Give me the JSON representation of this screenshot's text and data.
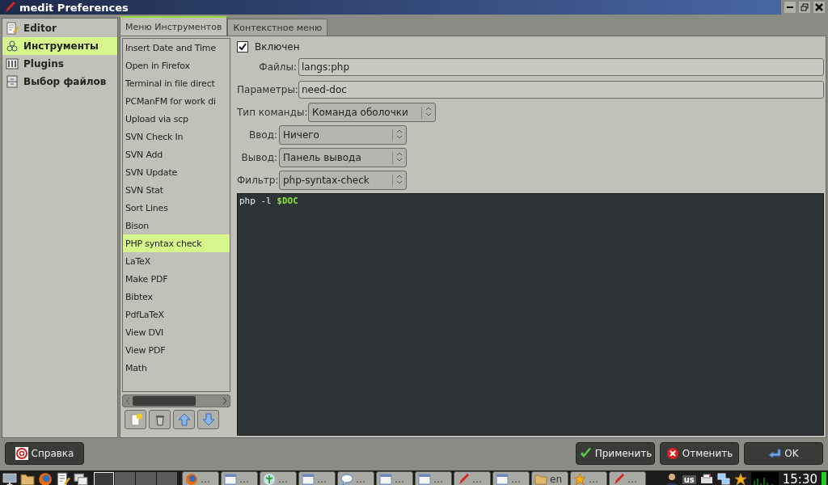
{
  "window": {
    "title": "medit Preferences"
  },
  "sidebar": {
    "items": [
      {
        "label": "Editor",
        "selected": false
      },
      {
        "label": "Инструменты",
        "selected": true
      },
      {
        "label": "Plugins",
        "selected": false
      },
      {
        "label": "Выбор файлов",
        "selected": false
      }
    ]
  },
  "tabs": [
    {
      "label": "Меню Инструментов",
      "selected": true
    },
    {
      "label": "Контекстное меню",
      "selected": false
    }
  ],
  "tools": {
    "items": [
      {
        "label": "Insert Date and Time",
        "selected": false
      },
      {
        "label": "Open in Firefox",
        "selected": false
      },
      {
        "label": "Terminal in file direct",
        "selected": false
      },
      {
        "label": "PCManFM for work di",
        "selected": false
      },
      {
        "label": "Upload via scp",
        "selected": false
      },
      {
        "label": "SVN Check In",
        "selected": false
      },
      {
        "label": "SVN Add",
        "selected": false
      },
      {
        "label": "SVN Update",
        "selected": false
      },
      {
        "label": "SVN Stat",
        "selected": false
      },
      {
        "label": "Sort Lines",
        "selected": false
      },
      {
        "label": "Bison",
        "selected": false
      },
      {
        "label": "PHP syntax check",
        "selected": true
      },
      {
        "label": "LaTeX",
        "selected": false
      },
      {
        "label": "Make PDF",
        "selected": false
      },
      {
        "label": "Bibtex",
        "selected": false
      },
      {
        "label": "PdfLaTeX",
        "selected": false
      },
      {
        "label": "View DVI",
        "selected": false
      },
      {
        "label": "View PDF",
        "selected": false
      },
      {
        "label": "Math",
        "selected": false
      }
    ]
  },
  "form": {
    "enabled": {
      "label": "Включен",
      "checked": true
    },
    "entries": [
      {
        "label": "Файлы:",
        "value": "langs:php"
      },
      {
        "label": "Параметры:",
        "value": "need-doc"
      }
    ],
    "command_type": {
      "label": "Тип команды:",
      "value": "Команда оболочки"
    },
    "io": [
      {
        "label": "Ввод:",
        "value": "Ничего"
      },
      {
        "label": "Вывод:",
        "value": "Панель вывода"
      },
      {
        "label": "Фильтр:",
        "value": "php-syntax-check"
      }
    ],
    "editor": [
      {
        "kind": "text",
        "text": "php -l "
      },
      {
        "kind": "variable",
        "text": "$DOC"
      }
    ]
  },
  "buttons_left": [
    {
      "label": "Справка"
    }
  ],
  "buttons_right": [
    {
      "label": "Применить"
    },
    {
      "label": "Отменить"
    },
    {
      "label": "OK"
    }
  ],
  "taskbar": {
    "pager": [
      {
        "selected": true
      },
      {
        "selected": false
      },
      {
        "selected": false
      },
      {
        "selected": false
      }
    ],
    "tasks": [
      {
        "label": "…"
      },
      {
        "label": "…"
      },
      {
        "label": "…"
      },
      {
        "label": "…"
      },
      {
        "label": "…"
      },
      {
        "label": "…"
      },
      {
        "label": "…"
      },
      {
        "label": "…"
      },
      {
        "label": "…"
      },
      {
        "label": "en"
      },
      {
        "label": "…"
      },
      {
        "label": "…"
      }
    ],
    "layout": "us",
    "clock": "15:30"
  }
}
